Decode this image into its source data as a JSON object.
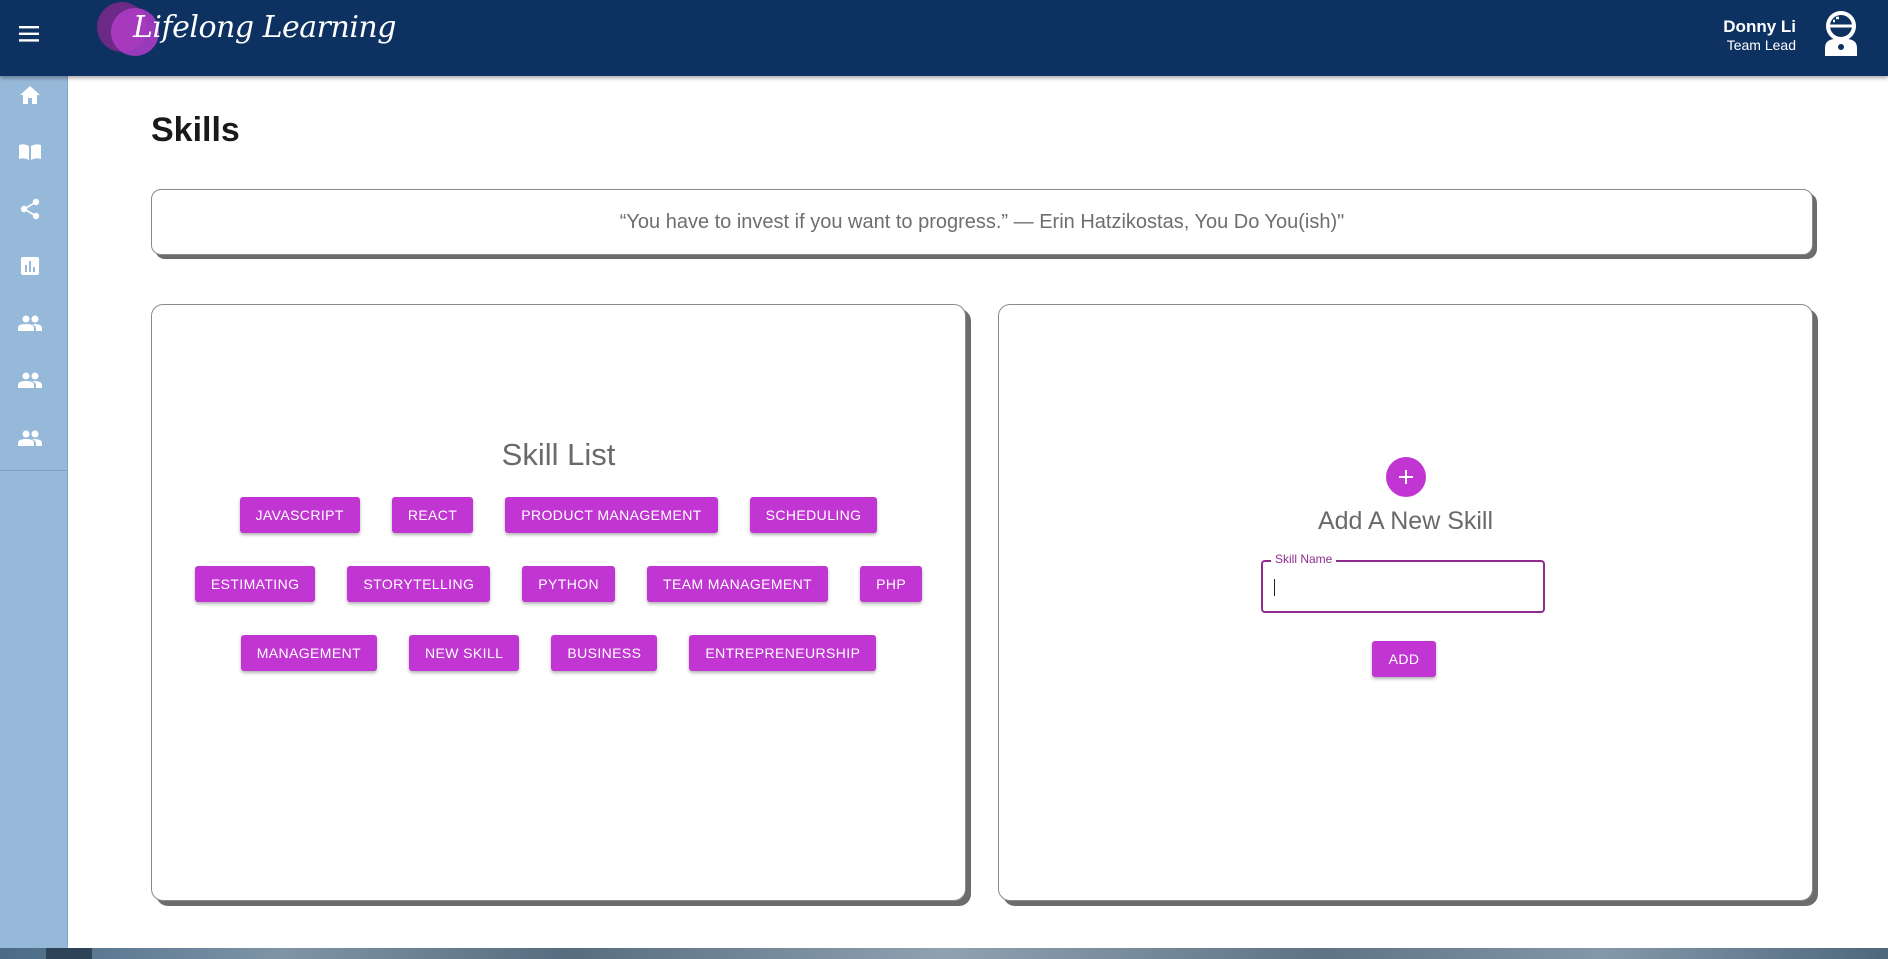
{
  "header": {
    "logo_text": "Lifelong Learning",
    "user_name": "Donny Li",
    "user_role": "Team Lead"
  },
  "sidebar": {
    "items": [
      {
        "icon": "home-icon"
      },
      {
        "icon": "book-icon"
      },
      {
        "icon": "share-icon"
      },
      {
        "icon": "bar-chart-icon"
      },
      {
        "icon": "people-icon"
      },
      {
        "icon": "people-icon"
      },
      {
        "icon": "people-icon"
      }
    ]
  },
  "page": {
    "title": "Skills",
    "quote": "“You have to invest if you want to progress.” — Erin Hatzikostas, You Do You(ish)\""
  },
  "skill_list": {
    "title": "Skill List",
    "rows": [
      [
        "JAVASCRIPT",
        "REACT",
        "PRODUCT MANAGEMENT",
        "SCHEDULING"
      ],
      [
        "ESTIMATING",
        "STORYTELLING",
        "PYTHON",
        "TEAM MANAGEMENT",
        "PHP"
      ],
      [
        "MANAGEMENT",
        "NEW SKILL",
        "BUSINESS",
        "ENTREPRENEURSHIP"
      ]
    ]
  },
  "add_skill": {
    "title": "Add A New Skill",
    "field_label": "Skill Name",
    "field_value": "",
    "button_label": "ADD"
  },
  "colors": {
    "topbar": "#0d3161",
    "sidebar": "#97b9d9",
    "accent": "#c136d2",
    "field_border": "#8e2d8f"
  }
}
